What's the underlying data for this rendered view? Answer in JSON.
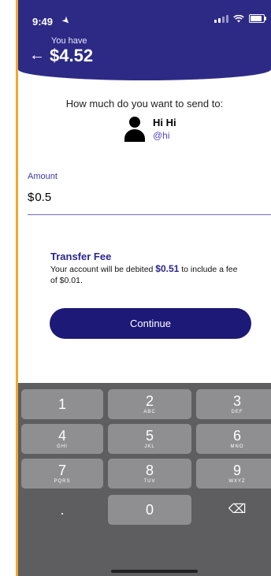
{
  "status": {
    "time": "9:49"
  },
  "header": {
    "you_have_label": "You have",
    "balance": "$4.52"
  },
  "recipient": {
    "prompt": "How much do you want to send to:",
    "name": "Hi Hi",
    "handle": "@hi"
  },
  "amount": {
    "label": "Amount",
    "currency": "$",
    "value": "0.5"
  },
  "fee": {
    "title": "Transfer Fee",
    "line_pre": "Your account will be debited ",
    "debit_amount": "$0.51",
    "line_post": " to include a fee of $0.01."
  },
  "actions": {
    "continue_label": "Continue"
  },
  "keyboard": {
    "keys": [
      {
        "id": "1",
        "main": "1",
        "sub": ""
      },
      {
        "id": "2",
        "main": "2",
        "sub": "ABC"
      },
      {
        "id": "3",
        "main": "3",
        "sub": "DEF"
      },
      {
        "id": "4",
        "main": "4",
        "sub": "GHI"
      },
      {
        "id": "5",
        "main": "5",
        "sub": "JKL"
      },
      {
        "id": "6",
        "main": "6",
        "sub": "MNO"
      },
      {
        "id": "7",
        "main": "7",
        "sub": "PQRS"
      },
      {
        "id": "8",
        "main": "8",
        "sub": "TUV"
      },
      {
        "id": "9",
        "main": "9",
        "sub": "WXYZ"
      },
      {
        "id": "dot",
        "main": ".",
        "sub": ""
      },
      {
        "id": "0",
        "main": "0",
        "sub": ""
      },
      {
        "id": "del",
        "main": "⌫",
        "sub": ""
      }
    ]
  },
  "colors": {
    "header": "#2d2a86",
    "accent": "#2a2690",
    "button": "#1d1977",
    "keyboard": "#5e5e60",
    "key": "#8f8f91",
    "edge": "#f1a82e"
  }
}
